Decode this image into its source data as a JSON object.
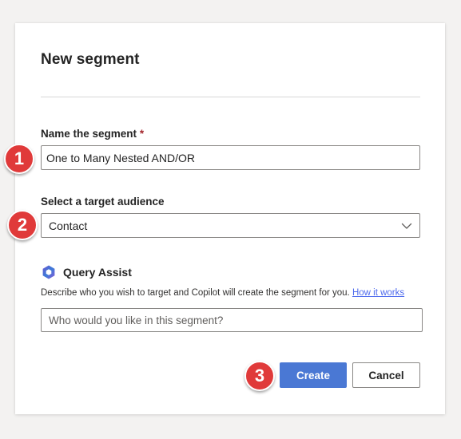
{
  "dialog": {
    "title": "New segment",
    "name_field": {
      "label": "Name the segment",
      "required_mark": "*",
      "value": "One to Many Nested AND/OR"
    },
    "audience_field": {
      "label": "Select a target audience",
      "selected": "Contact"
    },
    "query_assist": {
      "title": "Query Assist",
      "description": "Describe who you wish to target and Copilot will create the segment for you.",
      "link": "How it works",
      "placeholder": "Who would you like in this segment?"
    },
    "buttons": {
      "create": "Create",
      "cancel": "Cancel"
    }
  },
  "annotations": [
    "1",
    "2",
    "3"
  ],
  "colors": {
    "primary": "#4a78d4",
    "badge": "#e03a3a",
    "link": "#4f6bed"
  },
  "icons": {
    "dropdown": "chevron-down-icon",
    "query_assist": "copilot-icon"
  }
}
